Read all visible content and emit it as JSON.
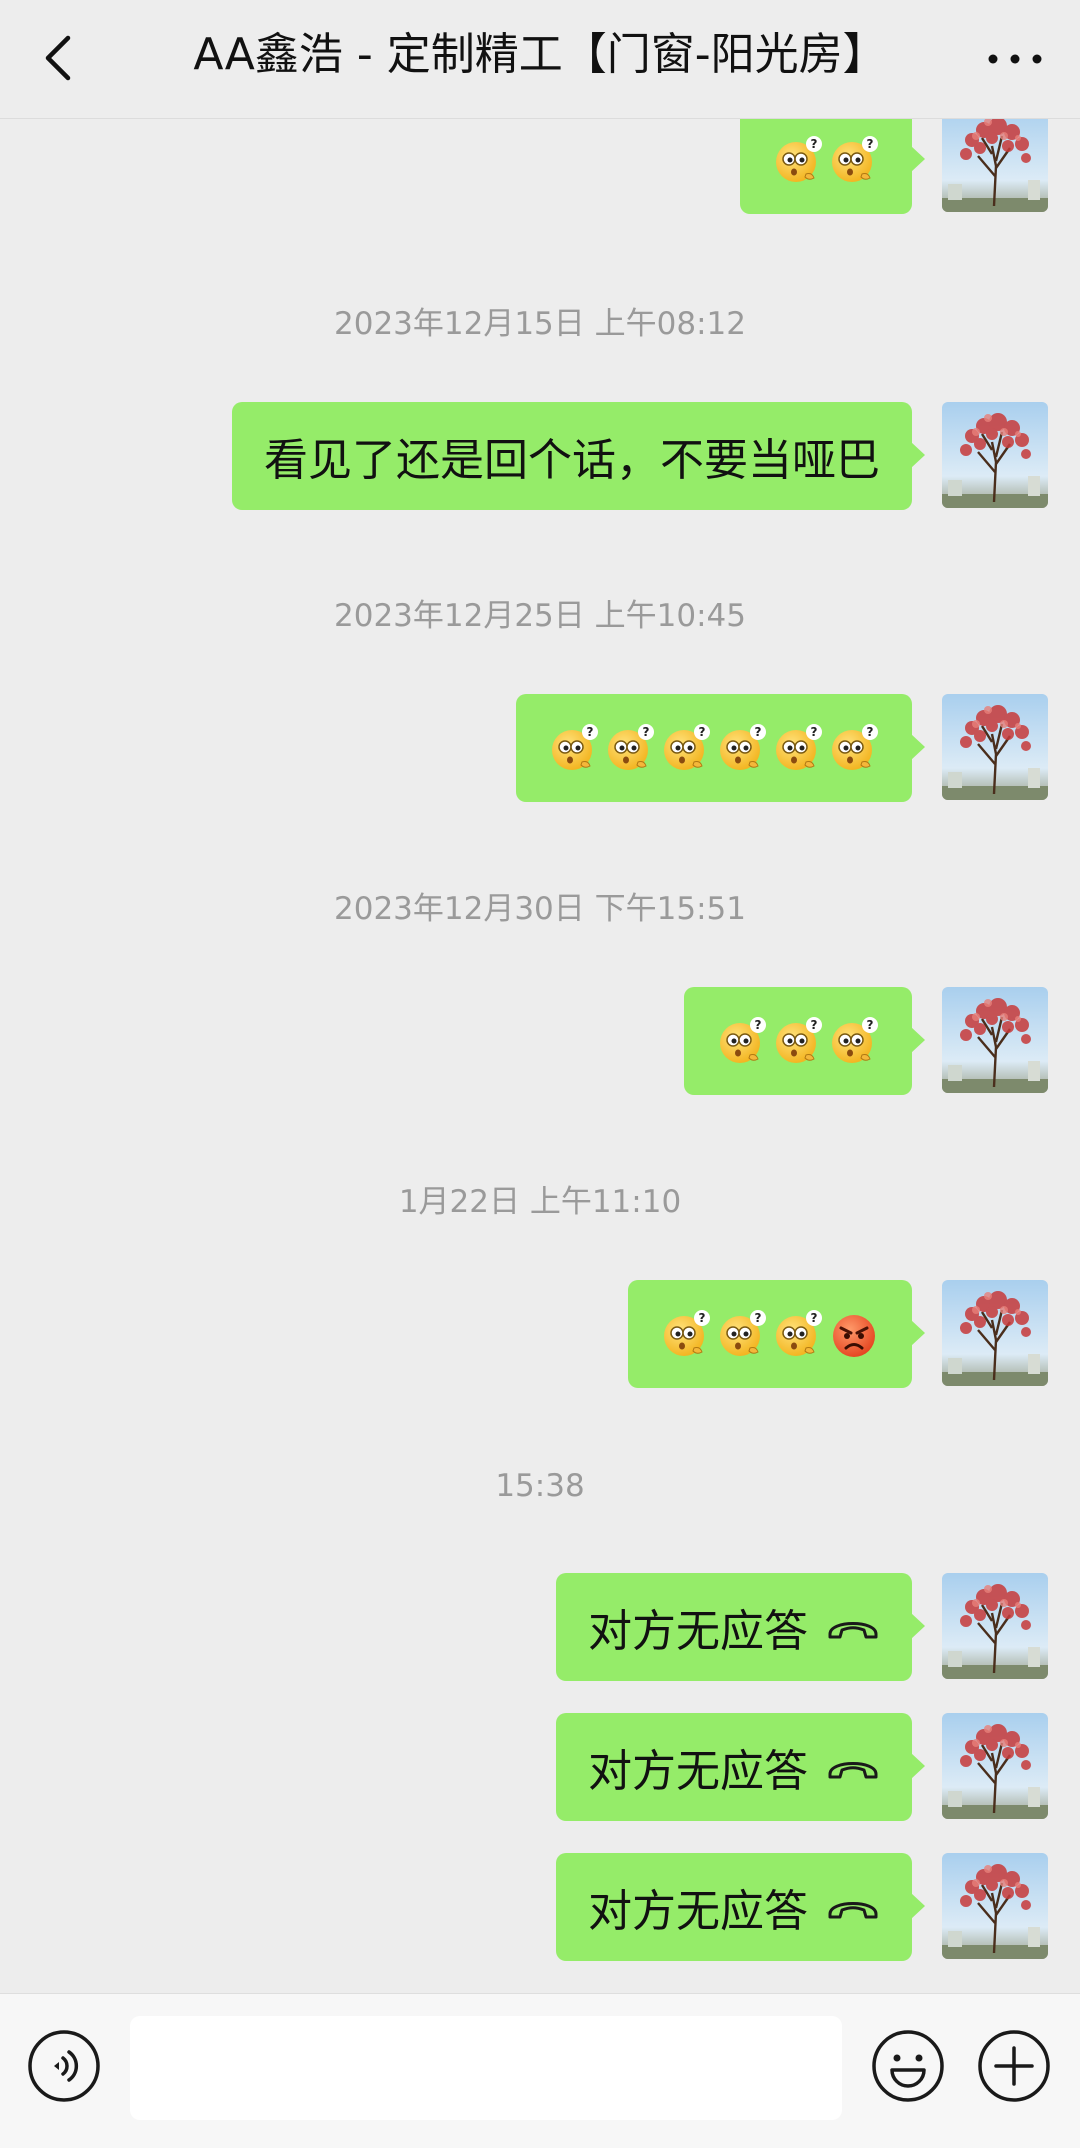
{
  "header": {
    "back_icon": "chevron-left-icon",
    "title": "AA鑫浩 - 定制精工【门窗-阳光房】",
    "more_icon": "more-horizontal-icon"
  },
  "chat": {
    "timestamps": [
      "2023年12月15日 上午08:12",
      "2023年12月25日 上午10:45",
      "2023年12月30日 下午15:51",
      "1月22日 上午11:10",
      "15:38"
    ],
    "messages": [
      {
        "type": "emoji",
        "emojis": [
          "confused",
          "confused"
        ]
      },
      {
        "type": "text",
        "text": "看见了还是回个话，不要当哑巴"
      },
      {
        "type": "emoji",
        "emojis": [
          "confused",
          "confused",
          "confused",
          "confused",
          "confused",
          "confused"
        ]
      },
      {
        "type": "emoji",
        "emojis": [
          "confused",
          "confused",
          "confused"
        ]
      },
      {
        "type": "emoji",
        "emojis": [
          "confused",
          "confused",
          "confused",
          "angry"
        ]
      },
      {
        "type": "call",
        "text": "对方无应答",
        "icon": "hang-up-icon"
      },
      {
        "type": "call",
        "text": "对方无应答",
        "icon": "hang-up-icon"
      },
      {
        "type": "call",
        "text": "对方无应答",
        "icon": "hang-up-icon"
      }
    ]
  },
  "input_bar": {
    "voice_icon": "voice-icon",
    "input_value": "",
    "emoji_icon": "smiley-icon",
    "plus_icon": "plus-icon"
  },
  "colors": {
    "background": "#ededed",
    "bubble": "#95ec69",
    "timestamp_text": "#9a9a9a"
  }
}
